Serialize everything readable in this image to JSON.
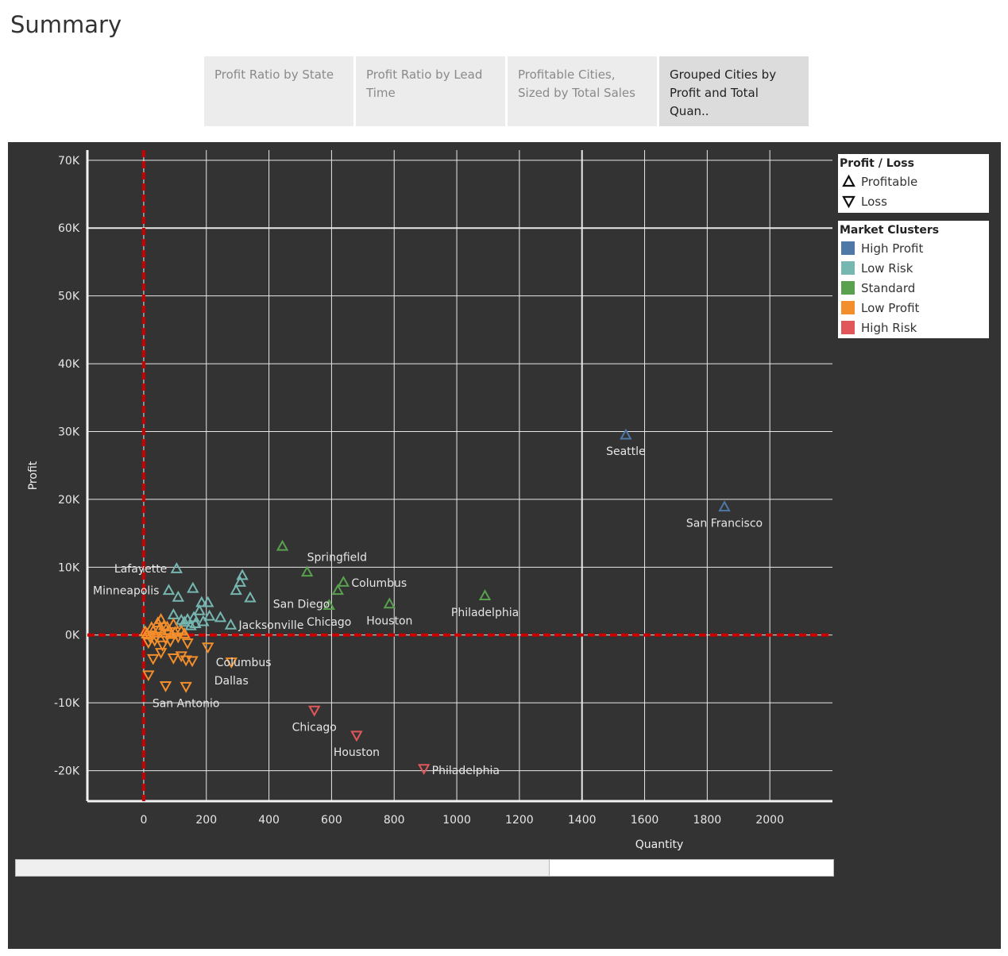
{
  "page": {
    "title": "Summary"
  },
  "tabs": [
    {
      "label": "Profit Ratio by State",
      "active": false
    },
    {
      "label": "Profit Ratio by Lead Time",
      "active": false
    },
    {
      "label": "Profitable Cities, Sized by Total Sales",
      "active": false
    },
    {
      "label": "Grouped Cities by Profit and Total Quan..",
      "active": true
    }
  ],
  "legend_shape": {
    "title": "Profit / Loss",
    "items": [
      {
        "label": "Profitable",
        "icon": "triangle-up-icon"
      },
      {
        "label": "Loss",
        "icon": "triangle-down-icon"
      }
    ]
  },
  "legend_color": {
    "title": "Market Clusters",
    "items": [
      {
        "label": "High Profit",
        "color": "#4e79a7"
      },
      {
        "label": "Low Risk",
        "color": "#76b7b2"
      },
      {
        "label": "Standard",
        "color": "#59a14f"
      },
      {
        "label": "Low Profit",
        "color": "#f28e2b"
      },
      {
        "label": "High Risk",
        "color": "#e15759"
      }
    ]
  },
  "chart_data": {
    "type": "scatter",
    "title": "",
    "xlabel": "Quantity",
    "ylabel": "Profit",
    "xlim": [
      -180,
      2200
    ],
    "ylim": [
      -24500,
      71500
    ],
    "x_ticks": [
      0,
      200,
      400,
      600,
      800,
      1000,
      1200,
      1400,
      1600,
      1800,
      2000
    ],
    "x_tick_labels": [
      "0",
      "200",
      "400",
      "600",
      "800",
      "1000",
      "1200",
      "1400",
      "1600",
      "1800",
      "2000"
    ],
    "y_ticks": [
      -20000,
      -10000,
      0,
      10000,
      20000,
      30000,
      40000,
      50000,
      60000,
      70000
    ],
    "y_tick_labels": [
      "-20K",
      "-10K",
      "0K",
      "10K",
      "20K",
      "30K",
      "40K",
      "50K",
      "60K",
      "70K"
    ],
    "grid": true,
    "reference_lines": {
      "x": 0,
      "y": 0,
      "color": "#cc0000",
      "style": "dashed"
    },
    "legend_position": "right",
    "series": [
      {
        "name": "High Profit",
        "color": "#4e79a7",
        "points": [
          {
            "x": 1540,
            "y": 29500,
            "label": "Seattle"
          },
          {
            "x": 1855,
            "y": 18900,
            "label": "San Francisco"
          }
        ]
      },
      {
        "name": "Low Risk",
        "color": "#76b7b2",
        "points": [
          {
            "x": 105,
            "y": 9800,
            "label": "Lafayette"
          },
          {
            "x": 80,
            "y": 6600,
            "label": "Minneapolis"
          },
          {
            "x": 278,
            "y": 1500,
            "label": "Jacksonville"
          },
          {
            "x": 315,
            "y": 8800
          },
          {
            "x": 308,
            "y": 7800
          },
          {
            "x": 295,
            "y": 6600
          },
          {
            "x": 340,
            "y": 5500
          },
          {
            "x": 157,
            "y": 6900
          },
          {
            "x": 110,
            "y": 5600
          },
          {
            "x": 185,
            "y": 4800
          },
          {
            "x": 205,
            "y": 4800
          },
          {
            "x": 178,
            "y": 3600
          },
          {
            "x": 245,
            "y": 2600
          },
          {
            "x": 210,
            "y": 2800
          },
          {
            "x": 160,
            "y": 2600
          },
          {
            "x": 140,
            "y": 2300
          },
          {
            "x": 120,
            "y": 2200
          },
          {
            "x": 190,
            "y": 2000
          },
          {
            "x": 165,
            "y": 1700
          },
          {
            "x": 150,
            "y": 1400
          },
          {
            "x": 95,
            "y": 3000
          },
          {
            "x": 130,
            "y": 1900
          }
        ]
      },
      {
        "name": "Standard",
        "color": "#59a14f",
        "points": [
          {
            "x": 443,
            "y": 13100
          },
          {
            "x": 522,
            "y": 9300,
            "label": "Springfield"
          },
          {
            "x": 620,
            "y": 6600,
            "label": "San Diego"
          },
          {
            "x": 638,
            "y": 7800,
            "label": "Columbus"
          },
          {
            "x": 592,
            "y": 4400,
            "label": "Chicago"
          },
          {
            "x": 785,
            "y": 4600,
            "label": "Houston"
          },
          {
            "x": 1090,
            "y": 5800,
            "label": "Philadelphia"
          }
        ]
      },
      {
        "name": "Low Profit",
        "color": "#f28e2b",
        "points": [
          {
            "x": 205,
            "y": -1800,
            "label": "Columbus"
          },
          {
            "x": 280,
            "y": -4000,
            "label": "Dallas"
          },
          {
            "x": 135,
            "y": -7600,
            "label": "San Antonio"
          },
          {
            "x": 15,
            "y": -5900
          },
          {
            "x": 70,
            "y": -7500
          },
          {
            "x": 95,
            "y": -3400
          },
          {
            "x": 120,
            "y": -3100
          },
          {
            "x": 135,
            "y": -3700
          },
          {
            "x": 155,
            "y": -3800
          },
          {
            "x": 30,
            "y": -3500
          },
          {
            "x": 55,
            "y": -2600
          },
          {
            "x": 140,
            "y": -1200
          },
          {
            "x": 10,
            "y": 200
          },
          {
            "x": 20,
            "y": -300
          },
          {
            "x": 30,
            "y": 600
          },
          {
            "x": 40,
            "y": -200
          },
          {
            "x": 50,
            "y": 900
          },
          {
            "x": 60,
            "y": 300
          },
          {
            "x": 70,
            "y": -500
          },
          {
            "x": 80,
            "y": 700
          },
          {
            "x": 90,
            "y": 100
          },
          {
            "x": 25,
            "y": 1100
          },
          {
            "x": 45,
            "y": 1800
          },
          {
            "x": 55,
            "y": 2300
          },
          {
            "x": 65,
            "y": 1400
          },
          {
            "x": 35,
            "y": -800
          },
          {
            "x": 75,
            "y": 1200
          },
          {
            "x": 85,
            "y": -900
          },
          {
            "x": 100,
            "y": 400
          },
          {
            "x": 110,
            "y": -300
          },
          {
            "x": 120,
            "y": 600
          },
          {
            "x": 15,
            "y": -1100
          },
          {
            "x": 5,
            "y": 500
          },
          {
            "x": 60,
            "y": -1500
          },
          {
            "x": 95,
            "y": 1600
          },
          {
            "x": 130,
            "y": 200
          }
        ]
      },
      {
        "name": "High Risk",
        "color": "#e15759",
        "points": [
          {
            "x": 545,
            "y": -11100,
            "label": "Chicago"
          },
          {
            "x": 680,
            "y": -14800,
            "label": "Houston"
          },
          {
            "x": 895,
            "y": -19700,
            "label": "Philadelphia"
          }
        ]
      }
    ]
  }
}
